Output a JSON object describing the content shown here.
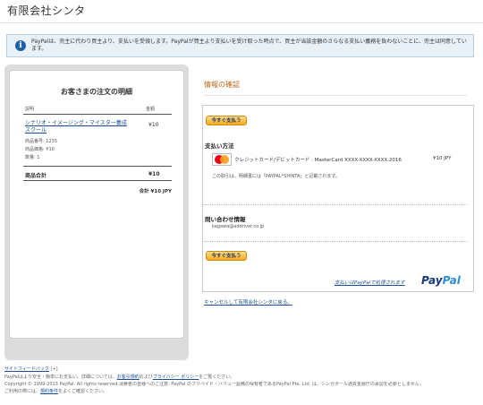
{
  "header": {
    "merchant_name": "有限会社シンタ"
  },
  "notice": {
    "text": "PayPalは、売主に代わり買主より、支払いを受領します。PayPalが買主より支払いを受け取った時点で、買主が当該金額のさらなる支払い義務を負わないことに、売主は同意しています。"
  },
  "cart": {
    "title": "お客さまの注文の明細",
    "col_desc": "説明",
    "col_amount": "金額",
    "item": {
      "name": "シナリオ・イメージング・マイスター養成スクール",
      "product_no": "商品番号: 1235",
      "price": "商品価格: ¥10",
      "qty": "数量: 1",
      "amount": "¥10"
    },
    "subtotal_label": "商品合計",
    "subtotal_value": "¥10",
    "total": "合計 ¥10 JPY"
  },
  "review": {
    "heading": "情報の確認",
    "pay_button": "今すぐ支払う",
    "payment_method_title": "支払い方法",
    "card_brand": "MasterCard",
    "card_text": "クレジットカード/デビットカード : MasterCard XXXX-XXXX-XXXX-2016",
    "card_amount": "¥10 JPY",
    "statement_note": "この取引は、明細書には「PAYPAL*SHINTA」と記載されます。",
    "contact_title": "問い合わせ情報",
    "contact_email": "kagawa@addriver.co.jp",
    "pay_button_2": "今すぐ支払う",
    "processed_by": "支払いはPayPalで処理されます",
    "logo_pay": "Pay",
    "logo_pal": "Pal",
    "cancel_link": "キャンセルして有限会社シンタに戻る。"
  },
  "footer": {
    "feedback": "サイトフィードバック",
    "feedback_mark": "[+]",
    "line1_a": "PayPalはより安全・簡単にお支払い。詳細については、",
    "terms": "お客引規約",
    "line1_b": "および",
    "privacy": "プライバシー ポリシー",
    "line1_c": "をご覧ください。",
    "line2": "Copyright © 1999-2013 PayPal. All rights reserved.消費者の皆様へのご注意: PayPal のプリペイド・バリュー設備の保有者であるPayPal Pte. Ltd. は、シンガポール通貨金融庁の承認を必要としません。",
    "line3_a": "ご利用の際には、",
    "terms2": "規約条件",
    "line3_b": "をよくご確認ください。"
  }
}
